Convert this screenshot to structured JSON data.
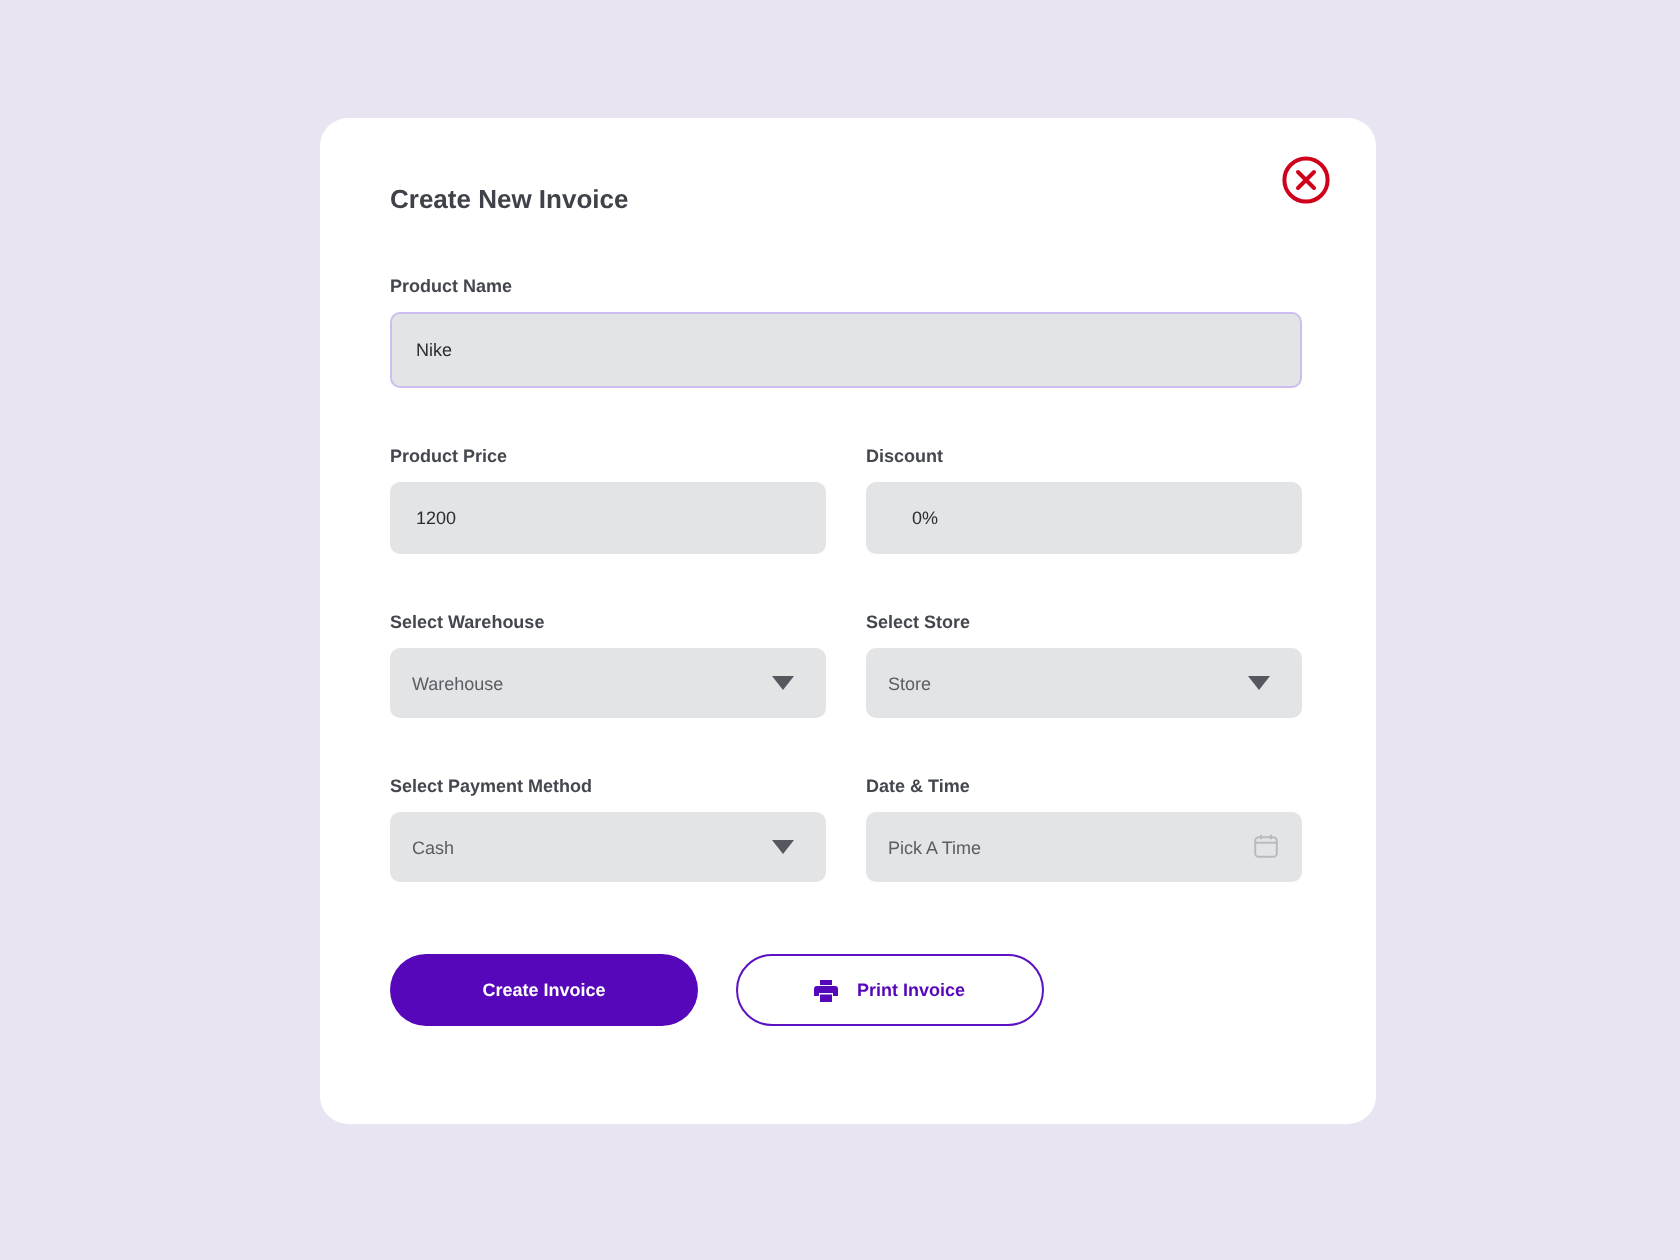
{
  "dialog": {
    "title": "Create New Invoice"
  },
  "rows": [
    {
      "fields": [
        {
          "kind": "text",
          "label": "Product Name",
          "value": "Nike",
          "focused": true
        }
      ]
    },
    {
      "fields": [
        {
          "kind": "text",
          "label": "Product Price",
          "value": "1200",
          "focused": false
        },
        {
          "kind": "percent",
          "label": "Discount",
          "value": "0%",
          "focused": false
        }
      ]
    },
    {
      "fields": [
        {
          "kind": "select",
          "label": "Select Warehouse",
          "value": "Warehouse",
          "focused": false
        },
        {
          "kind": "select",
          "label": "Select Store",
          "value": "Store",
          "focused": false
        }
      ]
    },
    {
      "fields": [
        {
          "kind": "select",
          "label": "Select Payment Method",
          "value": "Cash",
          "focused": false
        },
        {
          "kind": "date",
          "label": "Date & Time",
          "placeholder": "Pick A Time",
          "focused": false
        }
      ]
    }
  ],
  "buttons": [
    {
      "kind": "primary",
      "label": "Create Invoice"
    },
    {
      "kind": "outline",
      "label": "Print Invoice"
    }
  ]
}
